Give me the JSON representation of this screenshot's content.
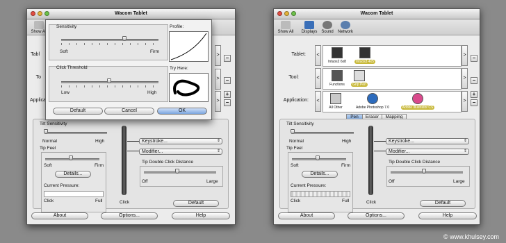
{
  "window_title": "Wacom Tablet",
  "toolbar": {
    "left": [
      "Show All"
    ],
    "right": [
      "Show All",
      "Displays",
      "Sound",
      "Network"
    ]
  },
  "rows": {
    "tablet": "Tablet:",
    "tool": "Tool:",
    "application": "Application:",
    "left_partial": [
      "Tabl",
      "To",
      "Applica"
    ]
  },
  "tablets": [
    {
      "name": "Intuos2 6x8",
      "selected": false
    },
    {
      "name": "Intuos3 4x5",
      "selected": true
    }
  ],
  "tools": [
    {
      "name": "Functions",
      "selected": false
    },
    {
      "name": "Grip Pen",
      "selected": true
    }
  ],
  "applications": [
    {
      "name": "All Other",
      "selected": false
    },
    {
      "name": "Adobe Photoshop 7.0",
      "selected": false
    },
    {
      "name": "Adobe Illustrator CS",
      "selected": true
    }
  ],
  "tabs": [
    "Pen",
    "Eraser",
    "Mapping"
  ],
  "tilt": {
    "title": "Tilt Sensitivity",
    "min": "Normal",
    "max": "High"
  },
  "tipfeel": {
    "title": "Tip Feel",
    "min": "Soft",
    "max": "Firm",
    "details": "Details..."
  },
  "pressure": {
    "title": "Current Pressure:",
    "min": "Click",
    "max": "Full"
  },
  "pen_click": "Click",
  "keystroke": "Keystroke...",
  "modifier": "Modifier...",
  "double_click": {
    "title": "Tip Double Click Distance",
    "min": "Off",
    "max": "Large"
  },
  "default_button": "Default",
  "footer": {
    "about": "About",
    "options": "Options...",
    "help": "Help"
  },
  "sheet": {
    "sensitivity": "Sensitivity",
    "soft": "Soft",
    "firm": "Firm",
    "profile": "Profile:",
    "click_threshold": "Click Threshold",
    "low": "Low",
    "high": "High",
    "try_here": "Try Here:",
    "default": "Default",
    "cancel": "Cancel",
    "ok": "OK"
  },
  "copyright": "© www.khulsey.com"
}
